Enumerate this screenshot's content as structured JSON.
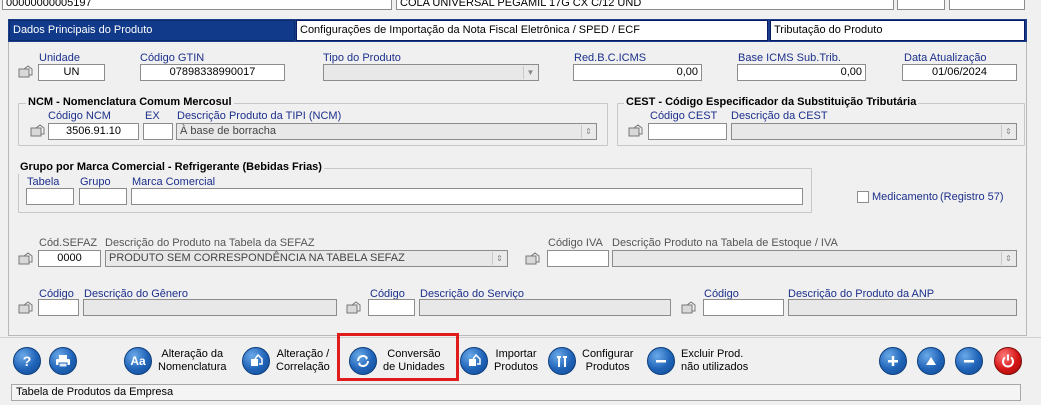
{
  "header": {
    "product_code": "00000000005197",
    "product_description": "COLA UNIVERSAL PEGAMIL 17G CX C/12 UND"
  },
  "tabs": [
    {
      "label": "Dados Principais do Produto"
    },
    {
      "label": "Configurações de Importação da Nota Fiscal Eletrônica / SPED / ECF"
    },
    {
      "label": "Tributação do Produto"
    }
  ],
  "row1": {
    "unidade_label": "Unidade",
    "unidade_value": "UN",
    "gtin_label": "Código GTIN",
    "gtin_value": "07898338990017",
    "tipo_label": "Tipo do Produto",
    "tipo_value": "",
    "redbc_label": "Red.B.C.ICMS",
    "redbc_value": "0,00",
    "baseicms_label": "Base ICMS Sub.Trib.",
    "baseicms_value": "0,00",
    "data_label": "Data Atualização",
    "data_value": "01/06/2024"
  },
  "ncm": {
    "title": "NCM - Nomenclatura Comum Mercosul",
    "codigo_label": "Código NCM",
    "codigo_value": "3506.91.10",
    "ex_label": "EX",
    "ex_value": "",
    "desc_label": "Descrição Produto da TIPI (NCM)",
    "desc_value": "À base de borracha"
  },
  "cest": {
    "title": "CEST - Código Especificador da Substituição Tributária",
    "codigo_label": "Código CEST",
    "codigo_value": "",
    "desc_label": "Descrição da CEST",
    "desc_value": ""
  },
  "grupo": {
    "title": "Grupo por Marca Comercial - Refrigerante (Bebidas Frias)",
    "tabela_label": "Tabela",
    "grupo_label": "Grupo",
    "marca_label": "Marca Comercial"
  },
  "medicamento": {
    "label": "Medicamento",
    "suffix": "(Registro  57)"
  },
  "sefaz": {
    "codigo_label": "Cód.SEFAZ",
    "codigo_value": "0000",
    "desc_label": "Descrição do Produto na Tabela da SEFAZ",
    "desc_value": "PRODUTO SEM CORRESPONDÊNCIA NA TABELA SEFAZ"
  },
  "iva": {
    "codigo_label": "Código IVA",
    "codigo_value": "",
    "desc_label": "Descrição Produto na Tabela de Estoque / IVA",
    "desc_value": ""
  },
  "genero": {
    "codigo_label": "Código",
    "desc_label": "Descrição do Gênero"
  },
  "servico": {
    "codigo_label": "Código",
    "desc_label": "Descrição do Serviço"
  },
  "anp": {
    "codigo_label": "Código",
    "desc_label": "Descrição do Produto da ANP"
  },
  "toolbar": {
    "alteracao_nomenclatura": [
      "Alteração da",
      "Nomenclatura"
    ],
    "alteracao_correlacao": [
      "Alteração /",
      "Correlação"
    ],
    "conversao": [
      "Conversão",
      "de Unidades"
    ],
    "importar": [
      "Importar",
      "Produtos"
    ],
    "configurar": [
      "Configurar",
      "Produtos"
    ],
    "excluir": [
      "Excluir Prod.",
      "não utilizados"
    ],
    "nomenclatura_icon_text": "Aa"
  },
  "status": {
    "text": "Tabela de Produtos da Empresa"
  },
  "colors": {
    "tab_active": "#123a8a",
    "label_blue": "#1c2f8c",
    "highlight": "#e01b1b"
  }
}
